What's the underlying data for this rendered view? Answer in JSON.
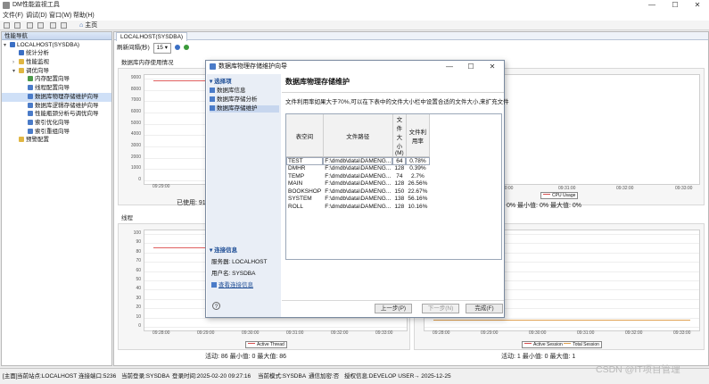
{
  "app": {
    "title": "DM性能监视工具",
    "window_controls": [
      "—",
      "☐",
      "✕"
    ]
  },
  "menu": [
    "文件(F)",
    "调试(D)",
    "窗口(W)",
    "帮助(H)"
  ],
  "toolbar": {
    "home_label": "主页"
  },
  "left_panel": {
    "tab_label": "性能导航",
    "tree": [
      {
        "label": "LOCALHOST(SYSDBA)",
        "icon": "server-icon",
        "color": "#3b6fc4"
      },
      {
        "label": "统计分析",
        "icon": "stats-icon",
        "color": "#3b6fc4"
      },
      {
        "label": "性能监视",
        "icon": "folder-icon",
        "color": "#e0b642"
      },
      {
        "label": "调优向导",
        "icon": "folder-icon",
        "color": "#e0b642"
      },
      {
        "label": "内存配置向导",
        "icon": "memory-icon",
        "color": "#4a9a4a"
      },
      {
        "label": "线程配置向导",
        "icon": "thread-icon",
        "color": "#4a7bc8"
      },
      {
        "label": "数据库物理存储维护向导",
        "icon": "storage-icon",
        "color": "#4a7bc8"
      },
      {
        "label": "数据库逻辑存储维护向导",
        "icon": "storage-icon",
        "color": "#4a7bc8"
      },
      {
        "label": "性能瓶颈分析与调优向导",
        "icon": "analysis-icon",
        "color": "#4a7bc8"
      },
      {
        "label": "索引优化向导",
        "icon": "index-icon",
        "color": "#4a7bc8"
      },
      {
        "label": "索引重组向导",
        "icon": "index-icon",
        "color": "#4a7bc8"
      },
      {
        "label": "预警配置",
        "icon": "alert-icon",
        "color": "#e0b642"
      }
    ]
  },
  "main": {
    "tab_label": "LOCALHOST(SYSDBA)",
    "refresh_label": "刷新间隔(秒)",
    "refresh_value": "15",
    "memory_title": "数据库内存使用情况",
    "memory_yticks": [
      "9000",
      "8000",
      "7000",
      "6000",
      "5000",
      "4000",
      "3000",
      "2000",
      "1000",
      "0"
    ],
    "memory_xticks": [
      "09:29:00"
    ],
    "memory_stats": "已使用: 91",
    "cpu_xticks": [
      "09:30:00",
      "09:31:00",
      "09:32:00",
      "09:33:00"
    ],
    "cpu_legend": "CPU Usage",
    "cpu_stats": "0%   最小值: 0%   最大值: 0%",
    "thread_title": "线程",
    "thread_yticks": [
      "100",
      "90",
      "80",
      "70",
      "60",
      "50",
      "40",
      "30",
      "20",
      "10",
      "0"
    ],
    "thread_xticks": [
      "09:28:00",
      "09:29:00",
      "09:30:00",
      "09:31:00",
      "09:32:00",
      "09:33:00"
    ],
    "thread_legend": "Active Thread",
    "thread_stats": "活动:  86    最小值:  0   最大值:  86",
    "session_xticks": [
      "09:28:00",
      "09:29:00",
      "09:30:00",
      "09:31:00",
      "09:32:00",
      "09:33:00"
    ],
    "session_legend": [
      "Active Session",
      "Total Session"
    ],
    "session_stats": "活动:  1    最小值:  0   最大值:  1"
  },
  "dialog": {
    "title": "数据库物理存储维护向导",
    "controls": [
      "—",
      "☐",
      "✕"
    ],
    "side_head": "选择项",
    "side_items": [
      "数据库信息",
      "数据库存储分析",
      "数据库存储维护"
    ],
    "conn_head": "连接信息",
    "server_label": "服务器: LOCALHOST",
    "user_label": "用户名: SYSDBA",
    "conn_link": "查看连接信息",
    "heading": "数据库物理存储维护",
    "description": "文件利用率如果大于70%,可以在下表中的文件大小栏中设置合适的文件大小,来扩充文件",
    "table": {
      "columns": [
        "表空间",
        "文件路径",
        "文件大小(M)",
        "文件利用率"
      ],
      "rows": [
        [
          "TEST",
          "F:\\dmdb\\data\\DAMENG...",
          "64",
          "0.78%"
        ],
        [
          "DMHR",
          "F:\\dmdb\\data\\DAMENG...",
          "128",
          "0.39%"
        ],
        [
          "TEMP",
          "F:\\dmdb\\data\\DAMENG...",
          "74",
          "2.7%"
        ],
        [
          "MAIN",
          "F:\\dmdb\\data\\DAMENG...",
          "128",
          "26.56%"
        ],
        [
          "BOOKSHOP",
          "F:\\dmdb\\data\\DAMENG...",
          "150",
          "22.67%"
        ],
        [
          "SYSTEM",
          "F:\\dmdb\\data\\DAMENG...",
          "138",
          "56.16%"
        ],
        [
          "ROLL",
          "F:\\dmdb\\data\\DAMENG...",
          "128",
          "10.16%"
        ]
      ]
    },
    "buttons": {
      "prev": "上一步(P)",
      "next": "下一步(N)",
      "finish": "完成(F)"
    },
    "help": "?"
  },
  "status": [
    "[主面]",
    "当前站点:LOCALHOST",
    "连接端口:5236",
    "当前登录:SYSDBA",
    "登录时间:2025-02-20 09:27:16",
    "当前模式:SYSDBA",
    "通信加密:否",
    "授权信息:DEVELOP USER",
    "→ 2025-12-25"
  ],
  "watermark": "CSDN @IT项目管理"
}
